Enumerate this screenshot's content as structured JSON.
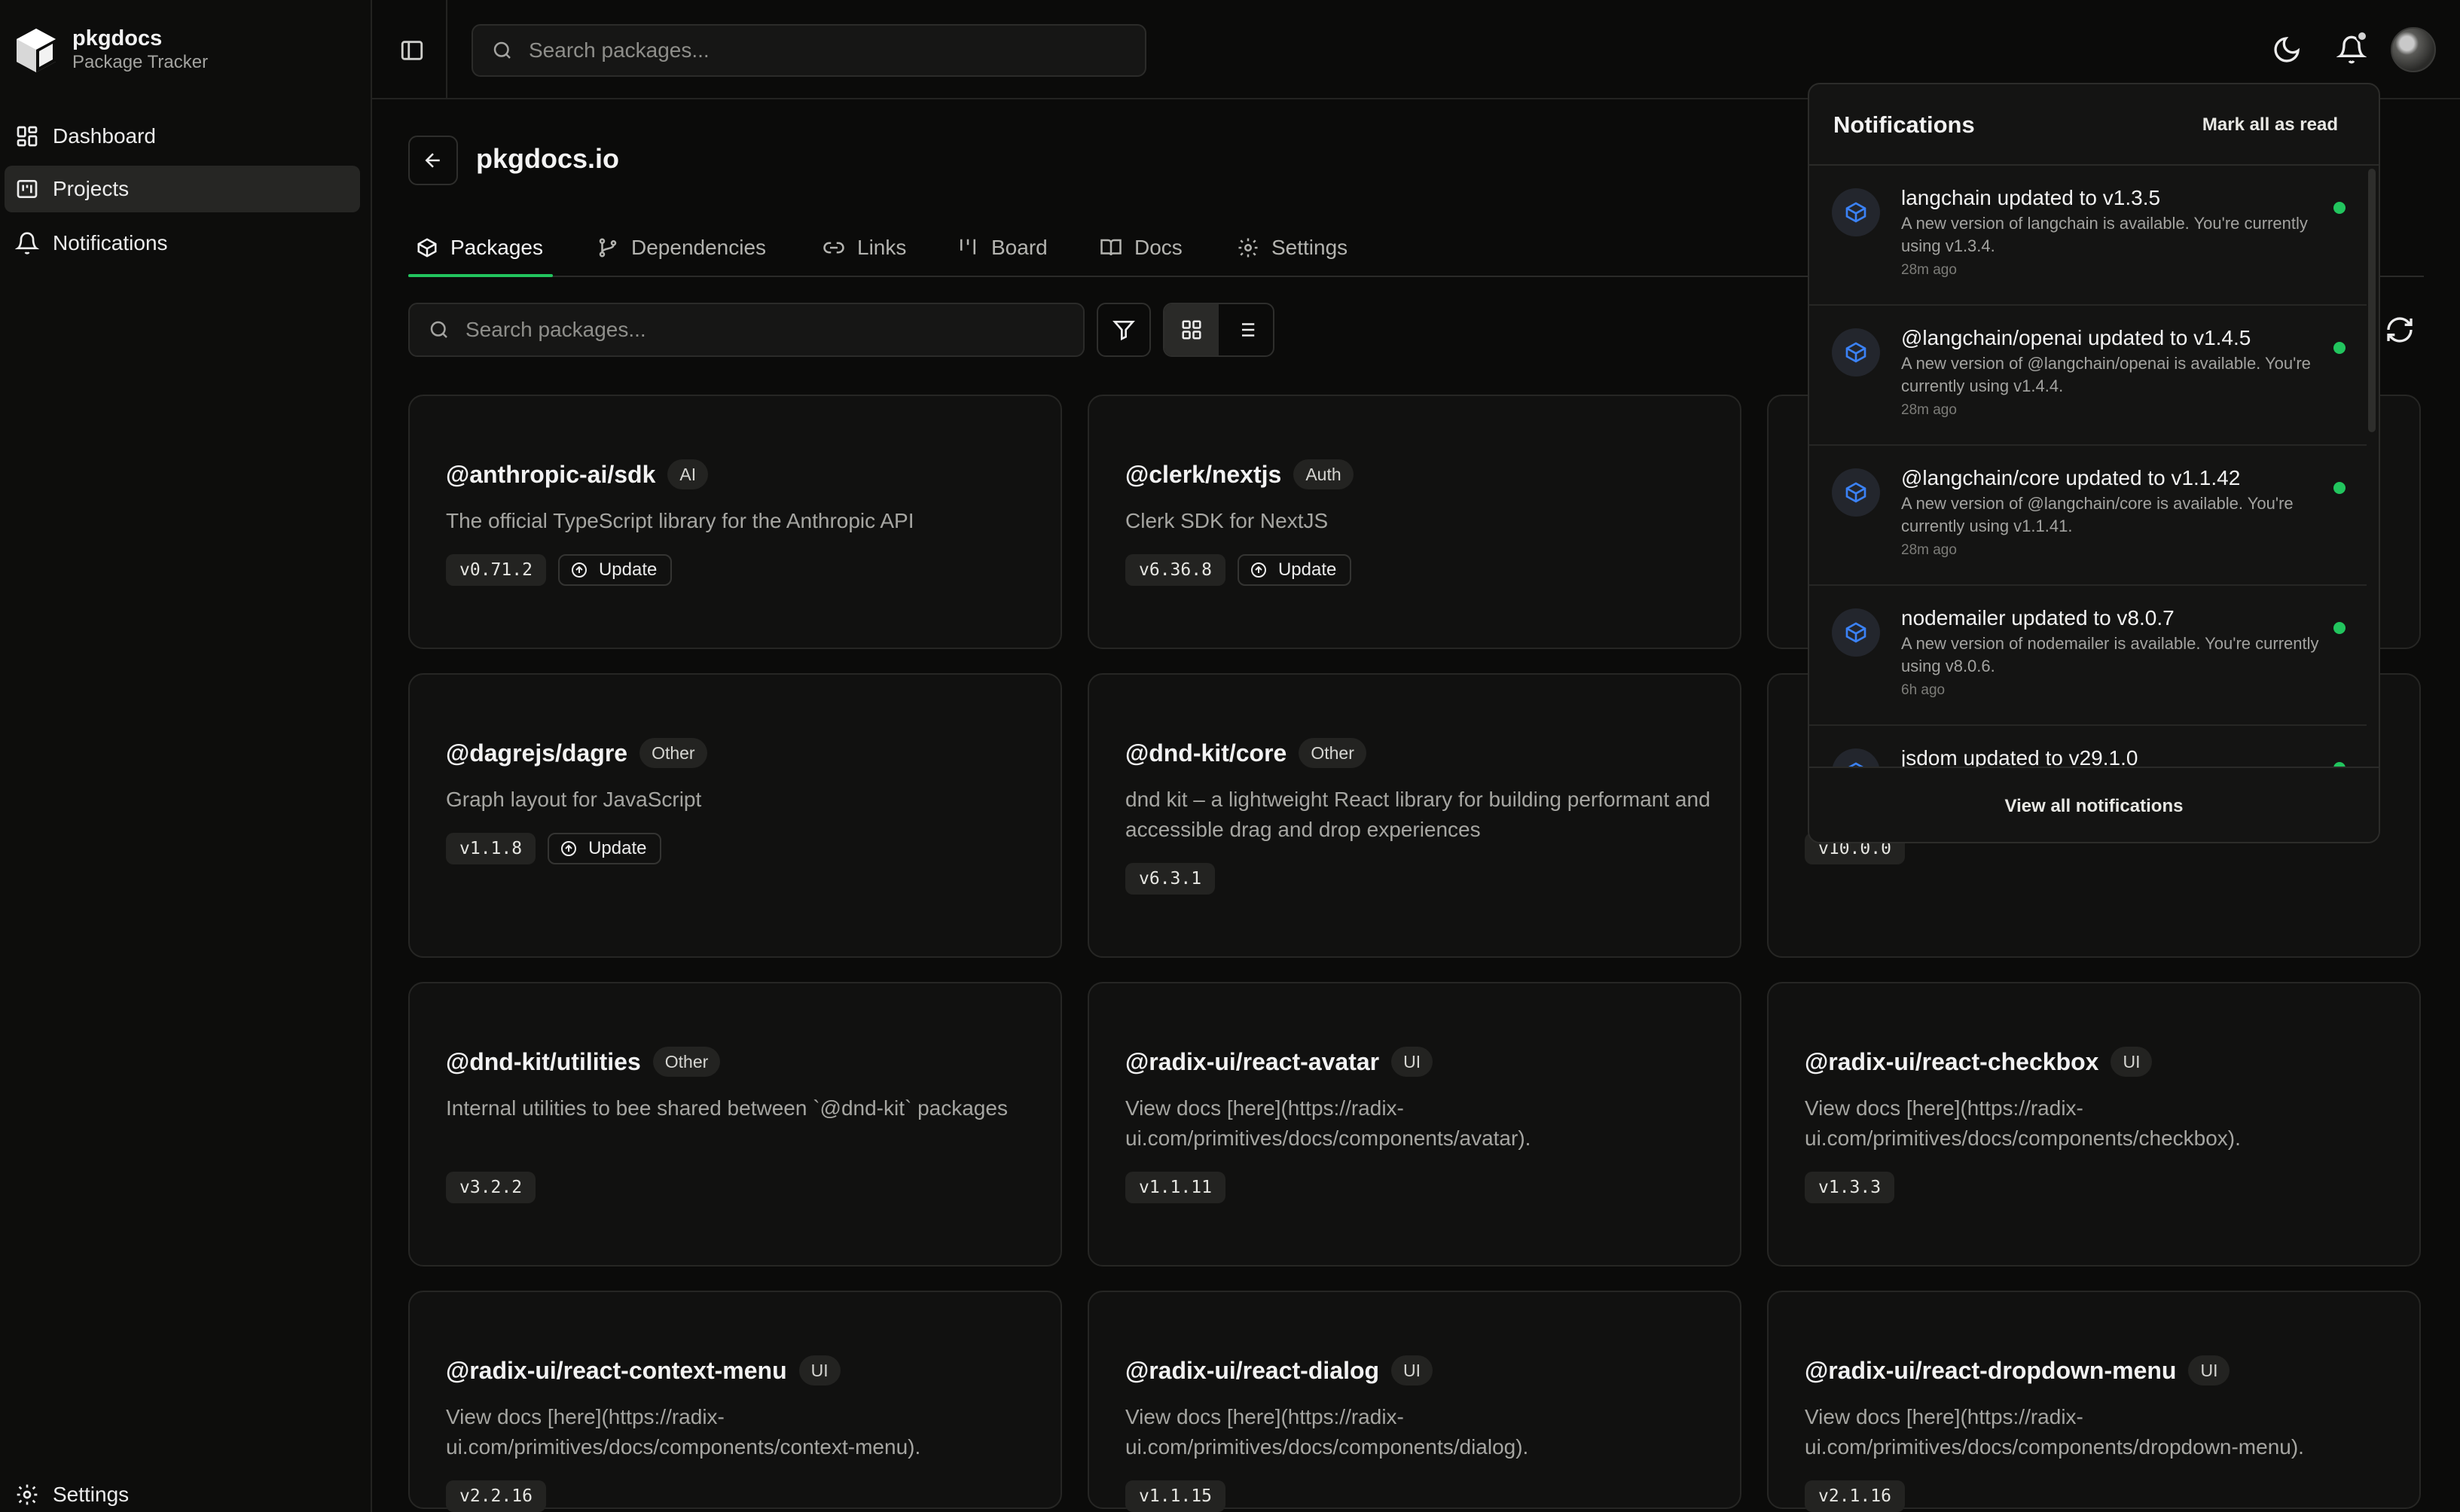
{
  "brand": {
    "name": "pkgdocs",
    "subtitle": "Package Tracker"
  },
  "sidebar": {
    "items": [
      {
        "label": "Dashboard",
        "icon": "dashboard-icon"
      },
      {
        "label": "Projects",
        "icon": "projects-icon",
        "active": true
      },
      {
        "label": "Notifications",
        "icon": "bell-icon"
      }
    ],
    "settings_label": "Settings"
  },
  "topbar": {
    "search_placeholder": "Search packages..."
  },
  "project": {
    "title": "pkgdocs.io",
    "tabs": [
      {
        "label": "Packages",
        "icon": "package-icon",
        "active": true
      },
      {
        "label": "Dependencies",
        "icon": "git-branch-icon"
      },
      {
        "label": "Links",
        "icon": "link-icon"
      },
      {
        "label": "Board",
        "icon": "kanban-icon"
      },
      {
        "label": "Docs",
        "icon": "book-icon"
      },
      {
        "label": "Settings",
        "icon": "gear-icon"
      }
    ],
    "search_placeholder": "Search packages...",
    "update_label": "Update"
  },
  "packages": [
    {
      "name": "@anthropic-ai/sdk",
      "tag": "AI",
      "description": "The official TypeScript library for the Anthropic API",
      "version": "v0.71.2",
      "has_update": true
    },
    {
      "name": "@clerk/nextjs",
      "tag": "Auth",
      "description": "Clerk SDK for NextJS",
      "version": "v6.36.8",
      "has_update": true
    },
    {
      "name": "",
      "tag": "",
      "description": "",
      "version": "",
      "has_update": false
    },
    {
      "name": "@dagrejs/dagre",
      "tag": "Other",
      "description": "Graph layout for JavaScript",
      "version": "v1.1.8",
      "has_update": true
    },
    {
      "name": "@dnd-kit/core",
      "tag": "Other",
      "description": "dnd kit – a lightweight React library for building performant and accessible drag and drop experiences",
      "version": "v6.3.1",
      "has_update": false
    },
    {
      "name": "",
      "tag": "",
      "description": "",
      "version": "v10.0.0",
      "has_update": false
    },
    {
      "name": "@dnd-kit/utilities",
      "tag": "Other",
      "description": "Internal utilities to bee shared between `@dnd-kit` packages",
      "version": "v3.2.2",
      "has_update": false
    },
    {
      "name": "@radix-ui/react-avatar",
      "tag": "UI",
      "description": "View docs [here](https://radix-ui.com/primitives/docs/components/avatar).",
      "version": "v1.1.11",
      "has_update": false
    },
    {
      "name": "@radix-ui/react-checkbox",
      "tag": "UI",
      "description": "View docs [here](https://radix-ui.com/primitives/docs/components/checkbox).",
      "version": "v1.3.3",
      "has_update": false
    },
    {
      "name": "@radix-ui/react-context-menu",
      "tag": "UI",
      "description": "View docs [here](https://radix-ui.com/primitives/docs/components/context-menu).",
      "version": "v2.2.16",
      "has_update": false
    },
    {
      "name": "@radix-ui/react-dialog",
      "tag": "UI",
      "description": "View docs [here](https://radix-ui.com/primitives/docs/components/dialog).",
      "version": "v1.1.15",
      "has_update": false
    },
    {
      "name": "@radix-ui/react-dropdown-menu",
      "tag": "UI",
      "description": "View docs [here](https://radix-ui.com/primitives/docs/components/dropdown-menu).",
      "version": "v2.1.16",
      "has_update": false
    }
  ],
  "notifications": {
    "title": "Notifications",
    "mark_all_label": "Mark all as read",
    "view_all_label": "View all notifications",
    "items": [
      {
        "headline": "langchain updated to v1.3.5",
        "body": "A new version of langchain is available. You're currently using v1.3.4.",
        "time": "28m ago",
        "unread": true
      },
      {
        "headline": "@langchain/openai updated to v1.4.5",
        "body": "A new version of @langchain/openai is available. You're currently using v1.4.4.",
        "time": "28m ago",
        "unread": true
      },
      {
        "headline": "@langchain/core updated to v1.1.42",
        "body": "A new version of @langchain/core is available. You're currently using v1.1.41.",
        "time": "28m ago",
        "unread": true
      },
      {
        "headline": "nodemailer updated to v8.0.7",
        "body": "A new version of nodemailer is available. You're currently using v8.0.6.",
        "time": "6h ago",
        "unread": true
      },
      {
        "headline": "jsdom updated to v29.1.0",
        "body": "",
        "time": "",
        "unread": true
      }
    ]
  },
  "colors": {
    "accent": "#22c55e",
    "notif_icon": "#3b82f6",
    "background": "#0b0b0a"
  }
}
